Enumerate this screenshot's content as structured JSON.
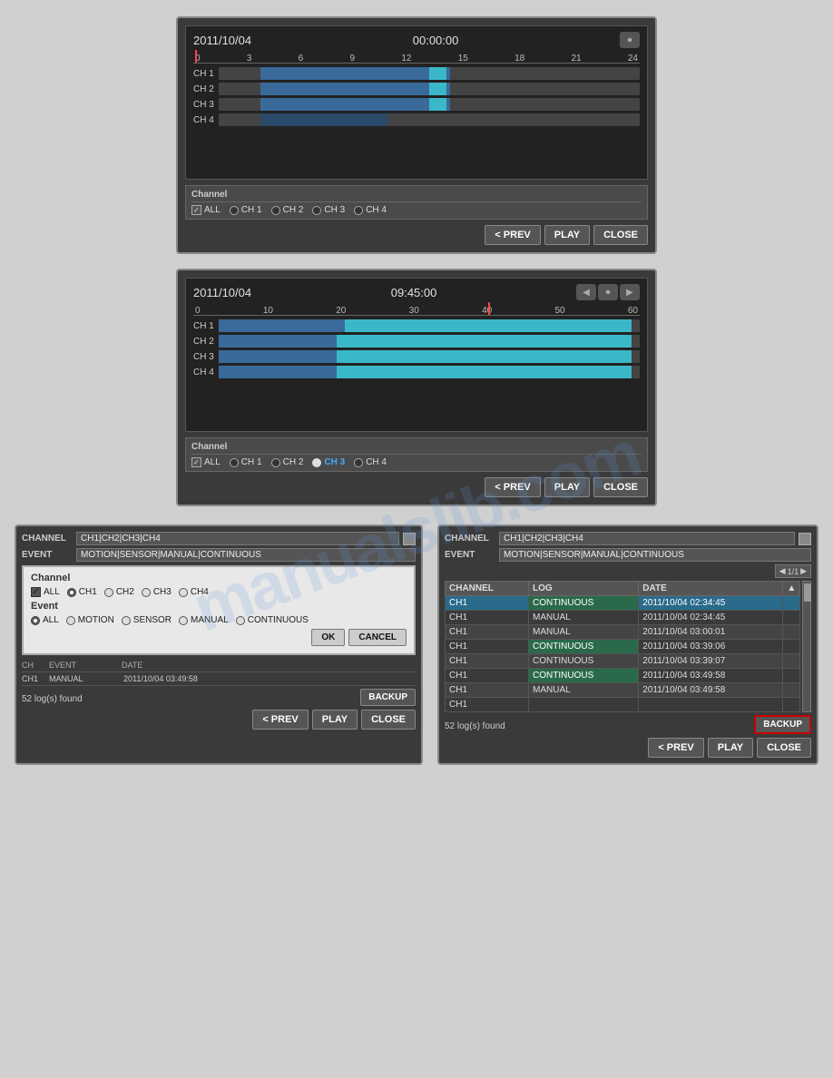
{
  "watermark": "manualslib.com",
  "panel1": {
    "date": "2011/10/04",
    "time": "00:00:00",
    "ruler": [
      "0",
      "3",
      "6",
      "9",
      "12",
      "15",
      "18",
      "21",
      "24"
    ],
    "channels": [
      {
        "label": "CH 1"
      },
      {
        "label": "CH 2"
      },
      {
        "label": "CH 3"
      },
      {
        "label": "CH 4"
      }
    ],
    "channel_section_title": "Channel",
    "channel_options": [
      "ALL",
      "CH 1",
      "CH 2",
      "CH 3",
      "CH 4"
    ],
    "buttons": {
      "prev": "< PREV",
      "play": "PLAY",
      "close": "CLOSE"
    }
  },
  "panel2": {
    "date": "2011/10/04",
    "time": "09:45:00",
    "ruler": [
      "0",
      "10",
      "20",
      "30",
      "40",
      "50",
      "60"
    ],
    "channels": [
      {
        "label": "CH 1"
      },
      {
        "label": "CH 2"
      },
      {
        "label": "CH 3"
      },
      {
        "label": "CH 4"
      }
    ],
    "channel_section_title": "Channel",
    "channel_options": [
      "ALL",
      "CH 1",
      "CH 2",
      "CH 3",
      "CH 4"
    ],
    "highlighted_channel": "CH 3",
    "buttons": {
      "prev": "< PREV",
      "play": "PLAY",
      "close": "CLOSE"
    }
  },
  "left_log_panel": {
    "channel_label": "CHANNEL",
    "channel_value": "CH1|CH2|CH3|CH4",
    "event_label": "EVENT",
    "event_value": "MOTION|SENSOR|MANUAL|CONTINUOUS",
    "filter_popup": {
      "channel_title": "Channel",
      "channel_options": [
        "ALL",
        "CH1",
        "CH2",
        "CH3",
        "CH4"
      ],
      "event_title": "Event",
      "event_options": [
        "ALL",
        "MOTION",
        "SENSOR",
        "MANUAL",
        "CONTINUOUS"
      ],
      "ok_label": "OK",
      "cancel_label": "CANCEL"
    },
    "log_rows": [
      {
        "ch": "CH1",
        "event": "MANUAL",
        "date": "2011/10/04 03:49:58"
      }
    ],
    "log_count": "52 log(s) found",
    "backup_label": "BACKUP",
    "buttons": {
      "prev": "< PREV",
      "play": "PLAY",
      "close": "CLOSE"
    }
  },
  "right_log_panel": {
    "channel_label": "CHANNEL",
    "channel_value": "CH1|CH2|CH3|CH4",
    "event_label": "EVENT",
    "event_value": "MOTION|SENSOR|MANUAL|CONTINUOUS",
    "page_indicator": "1/1",
    "table_headers": [
      "CHANNEL",
      "LOG",
      "DATE"
    ],
    "table_rows": [
      {
        "ch": "CH1",
        "log": "CONTINUOUS",
        "date": "2011/10/04 02:34:45",
        "highlight": true
      },
      {
        "ch": "CH1",
        "log": "MANUAL",
        "date": "2011/10/04 02:34:45",
        "highlight": false
      },
      {
        "ch": "CH1",
        "log": "MANUAL",
        "date": "2011/10/04 03:00:01",
        "highlight": false
      },
      {
        "ch": "CH1",
        "log": "CONTINUOUS",
        "date": "2011/10/04 03:39:06",
        "highlight": true
      },
      {
        "ch": "CH1",
        "log": "CONTINUOUS",
        "date": "2011/10/04 03:39:07",
        "highlight": false
      },
      {
        "ch": "CH1",
        "log": "CONTINUOUS",
        "date": "2011/10/04 03:49:58",
        "highlight": true
      },
      {
        "ch": "CH1",
        "log": "MANUAL",
        "date": "2011/10/04 03:49:58",
        "highlight": false
      },
      {
        "ch": "CH1",
        "log": "",
        "date": "",
        "highlight": false
      }
    ],
    "log_count": "52 log(s) found",
    "backup_label": "BACKUP",
    "buttons": {
      "prev": "< PREV",
      "play": "PLAY",
      "close": "CLOSE"
    }
  }
}
